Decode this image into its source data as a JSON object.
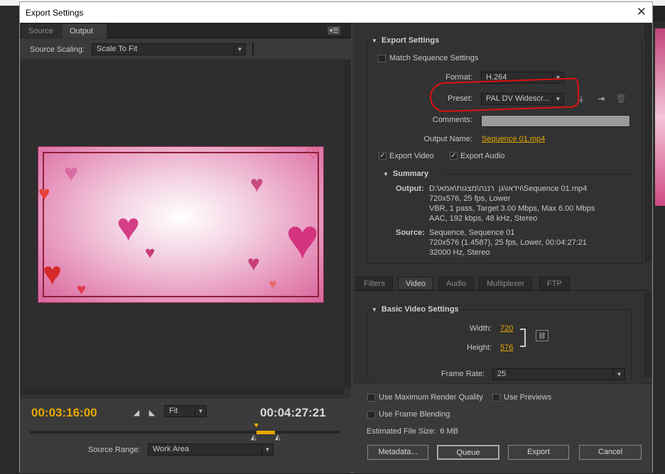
{
  "window": {
    "title": "Export Settings",
    "close": "✕"
  },
  "left": {
    "tabs": [
      "Source",
      "Output"
    ],
    "panel_menu": "▾☰",
    "source_scaling_label": "Source Scaling:",
    "source_scaling_value": "Scale To Fit",
    "timecode_current": "00:03:16:00",
    "timecode_duration": "00:04:27:21",
    "zoom_value": "Fit",
    "source_range_label": "Source Range:",
    "source_range_value": "Work Area"
  },
  "export_settings": {
    "section": "Export Settings",
    "match_sequence": "Match Sequence Settings",
    "format_label": "Format:",
    "format_value": "H.264",
    "preset_label": "Preset:",
    "preset_value": "PAL DV Widescr...",
    "comments_label": "Comments:",
    "output_name_label": "Output Name:",
    "output_name_value": "Sequence 01.mp4",
    "export_video": "Export Video",
    "export_audio": "Export Audio"
  },
  "summary": {
    "title": "Summary",
    "output_label": "Output:",
    "output_lines": [
      "D:\\וידאו\\גן  רננה\\מצגות\\אמא\\Sequence 01.mp4",
      "720x576, 25 fps, Lower",
      "VBR, 1 pass, Target 3.00 Mbps, Max 6.00 Mbps",
      "AAC, 192 kbps, 48 kHz, Stereo"
    ],
    "source_label": "Source:",
    "source_lines": [
      "Sequence, Sequence 01",
      "720x576 (1.4587), 25 fps, Lower, 00:04:27:21",
      "32000 Hz, Stereo"
    ]
  },
  "tabs": [
    "Filters",
    "Video",
    "Audio",
    "Multiplexer",
    "FTP"
  ],
  "video": {
    "section": "Basic Video Settings",
    "width_label": "Width:",
    "width_value": "720",
    "height_label": "Height:",
    "height_value": "576",
    "frame_rate_label": "Frame Rate:",
    "frame_rate_value": "25"
  },
  "bottom": {
    "max_render": "Use Maximum Render Quality",
    "use_previews": "Use Previews",
    "frame_blending": "Use Frame Blending",
    "file_size": "Estimated File Size:  6 MB",
    "buttons": [
      "Metadata...",
      "Queue",
      "Export",
      "Cancel"
    ]
  },
  "colors": {
    "accent": "#e8a800",
    "annotation": "#e01010"
  }
}
